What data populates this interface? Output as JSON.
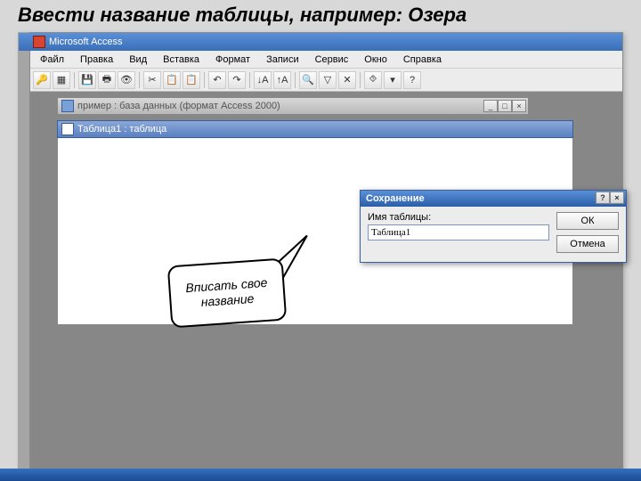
{
  "slide": {
    "title": "Ввести название таблицы, например: Озера"
  },
  "app": {
    "title": "Microsoft Access",
    "menu": [
      "Файл",
      "Правка",
      "Вид",
      "Вставка",
      "Формат",
      "Записи",
      "Сервис",
      "Окно",
      "Справка"
    ]
  },
  "db_window": {
    "title": "пример : база данных (формат Access 2000)"
  },
  "table_window": {
    "title": "Таблица1 : таблица"
  },
  "dialog": {
    "title": "Сохранение",
    "label": "Имя таблицы:",
    "value": "Таблица1",
    "ok": "ОК",
    "cancel": "Отмена",
    "help": "?",
    "close": "×"
  },
  "callout": {
    "text": "Вписать свое название"
  },
  "toolbar_icons": [
    "🔑",
    "▦",
    "💾",
    "🖶",
    "👁",
    "✂",
    "📋",
    "📋",
    "↶",
    "↷",
    "↓A",
    "↑A",
    "🔍",
    "▽",
    "✕",
    "⯑",
    "▾",
    "?"
  ]
}
